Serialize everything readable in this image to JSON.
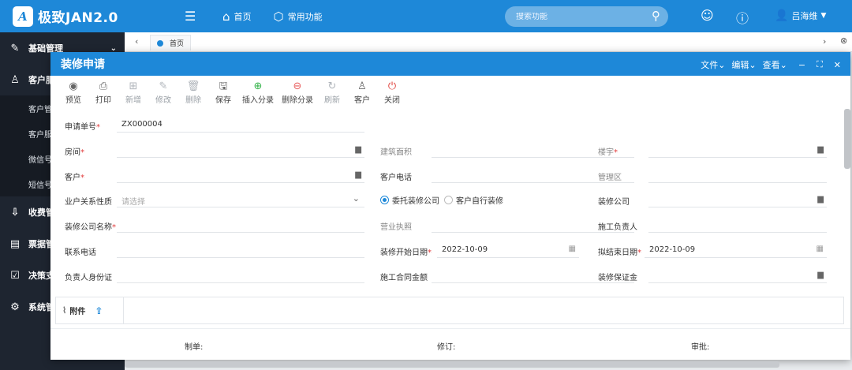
{
  "topbar": {
    "logo_mark": "A",
    "logo_text": "极致JAN2.0",
    "nav": [
      {
        "label": "首页"
      },
      {
        "label": "常用功能"
      }
    ],
    "search_placeholder": "搜索功能",
    "user_name": "吕海维"
  },
  "sidebar": {
    "items": [
      {
        "label": "基础管理"
      },
      {
        "label": "客户服"
      },
      {
        "label": "收费管"
      },
      {
        "label": "票据管"
      },
      {
        "label": "决策支"
      },
      {
        "label": "系统管"
      }
    ],
    "subitems": [
      {
        "label": "客户管"
      },
      {
        "label": "客户服"
      },
      {
        "label": "微信号"
      },
      {
        "label": "短信号"
      }
    ]
  },
  "tabs": {
    "home": "首页"
  },
  "dialog": {
    "title": "装修申请",
    "menus": [
      {
        "label": "文件"
      },
      {
        "label": "编辑"
      },
      {
        "label": "查看"
      }
    ],
    "toolbar": [
      {
        "label": "预览"
      },
      {
        "label": "打印"
      },
      {
        "label": "新增"
      },
      {
        "label": "修改"
      },
      {
        "label": "删除"
      },
      {
        "label": "保存"
      },
      {
        "label": "插入分录"
      },
      {
        "label": "删除分录"
      },
      {
        "label": "刷新"
      },
      {
        "label": "客户"
      },
      {
        "label": "关闭"
      }
    ],
    "form": {
      "apply_no_label": "申请单号",
      "apply_no_value": "ZX000004",
      "room_label": "房间",
      "area_label": "建筑面积",
      "building_label": "楼宇",
      "customer_label": "客户",
      "customer_phone_label": "客户电话",
      "manage_area_label": "管理区",
      "relation_label": "业户关系性质",
      "relation_placeholder": "请选择",
      "radio_company": "委托装修公司",
      "radio_self": "客户自行装修",
      "deco_company_label": "装修公司",
      "deco_company_name_label": "装修公司名称",
      "license_label": "营业执照",
      "construction_lead_label": "施工负责人",
      "contact_phone_label": "联系电话",
      "start_date_label": "装修开始日期",
      "start_date_value": "2022-10-09",
      "end_date_label": "拟结束日期",
      "end_date_value": "2022-10-09",
      "lead_id_label": "负责人身份证",
      "contract_amount_label": "施工合同金额",
      "deposit_label": "装修保证金"
    },
    "attachment_label": "附件",
    "footer": {
      "maker": "制单:",
      "reviser": "修订:",
      "approver": "审批:"
    }
  }
}
